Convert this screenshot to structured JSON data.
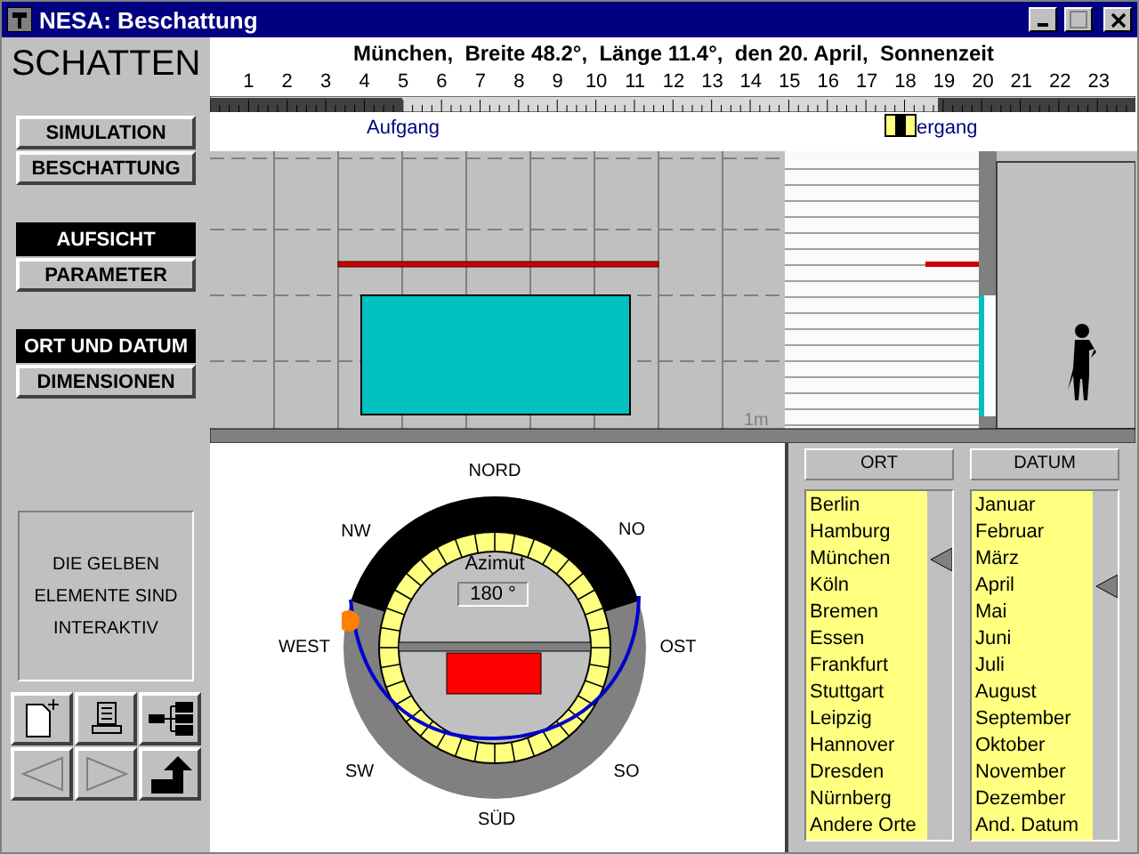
{
  "window": {
    "title": "NESA: Beschattung"
  },
  "sidebar": {
    "heading": "SCHATTEN",
    "groups": [
      [
        {
          "label": "SIMULATION",
          "selected": false
        },
        {
          "label": "BESCHATTUNG",
          "selected": false
        }
      ],
      [
        {
          "label": "AUFSICHT",
          "selected": true
        },
        {
          "label": "PARAMETER",
          "selected": false
        }
      ],
      [
        {
          "label": "ORT UND DATUM",
          "selected": true
        },
        {
          "label": "DIMENSIONEN",
          "selected": false
        }
      ]
    ],
    "info_lines": [
      "DIE GELBEN",
      "ELEMENTE SIND",
      "INTERAKTIV"
    ],
    "toolbar": [
      {
        "kind": "new",
        "disabled": false
      },
      {
        "kind": "print",
        "disabled": false
      },
      {
        "kind": "tree",
        "disabled": false
      },
      {
        "kind": "back",
        "disabled": true
      },
      {
        "kind": "forward",
        "disabled": true
      },
      {
        "kind": "exit",
        "disabled": false
      }
    ]
  },
  "header": {
    "title": "München,  Breite 48.2°,  Länge 11.4°,  den 20. April,  Sonnenzeit",
    "hours": [
      "1",
      "2",
      "3",
      "4",
      "5",
      "6",
      "7",
      "8",
      "9",
      "10",
      "11",
      "12",
      "13",
      "14",
      "15",
      "16",
      "17",
      "18",
      "19",
      "20",
      "21",
      "22",
      "23"
    ],
    "sunrise_label": "Aufgang",
    "sunset_label": "ergang",
    "time_slider": {
      "level": 0.745
    }
  },
  "facade": {
    "scale_label": "1m"
  },
  "compass": {
    "directions": [
      {
        "kind": "n",
        "label": "NORD"
      },
      {
        "kind": "nw",
        "label": "NW"
      },
      {
        "kind": "no",
        "label": "NO"
      },
      {
        "kind": "w",
        "label": "WEST"
      },
      {
        "kind": "o",
        "label": "OST"
      },
      {
        "kind": "sw",
        "label": "SW"
      },
      {
        "kind": "so",
        "label": "SO"
      },
      {
        "kind": "s",
        "label": "SÜD"
      }
    ],
    "azimuth_label": "Azimut",
    "azimuth_value": "180 °"
  },
  "lists": [
    {
      "title": "ORT",
      "items": [
        {
          "label": "Berlin",
          "selected": false
        },
        {
          "label": "Hamburg",
          "selected": false
        },
        {
          "label": "München",
          "selected": true
        },
        {
          "label": "Köln",
          "selected": false
        },
        {
          "label": "Bremen",
          "selected": false
        },
        {
          "label": "Essen",
          "selected": false
        },
        {
          "label": "Frankfurt",
          "selected": false
        },
        {
          "label": "Stuttgart",
          "selected": false
        },
        {
          "label": "Leipzig",
          "selected": false
        },
        {
          "label": "Hannover",
          "selected": false
        },
        {
          "label": "Dresden",
          "selected": false
        },
        {
          "label": "Nürnberg",
          "selected": false
        },
        {
          "label": "Andere Orte",
          "selected": false
        }
      ]
    },
    {
      "title": "DATUM",
      "items": [
        {
          "label": "Januar",
          "selected": false
        },
        {
          "label": "Februar",
          "selected": false
        },
        {
          "label": "März",
          "selected": false
        },
        {
          "label": "April",
          "selected": true
        },
        {
          "label": "Mai",
          "selected": false
        },
        {
          "label": "Juni",
          "selected": false
        },
        {
          "label": "Juli",
          "selected": false
        },
        {
          "label": "August",
          "selected": false
        },
        {
          "label": "September",
          "selected": false
        },
        {
          "label": "Oktober",
          "selected": false
        },
        {
          "label": "November",
          "selected": false
        },
        {
          "label": "Dezember",
          "selected": false
        },
        {
          "label": "And. Datum",
          "selected": false
        }
      ]
    }
  ]
}
